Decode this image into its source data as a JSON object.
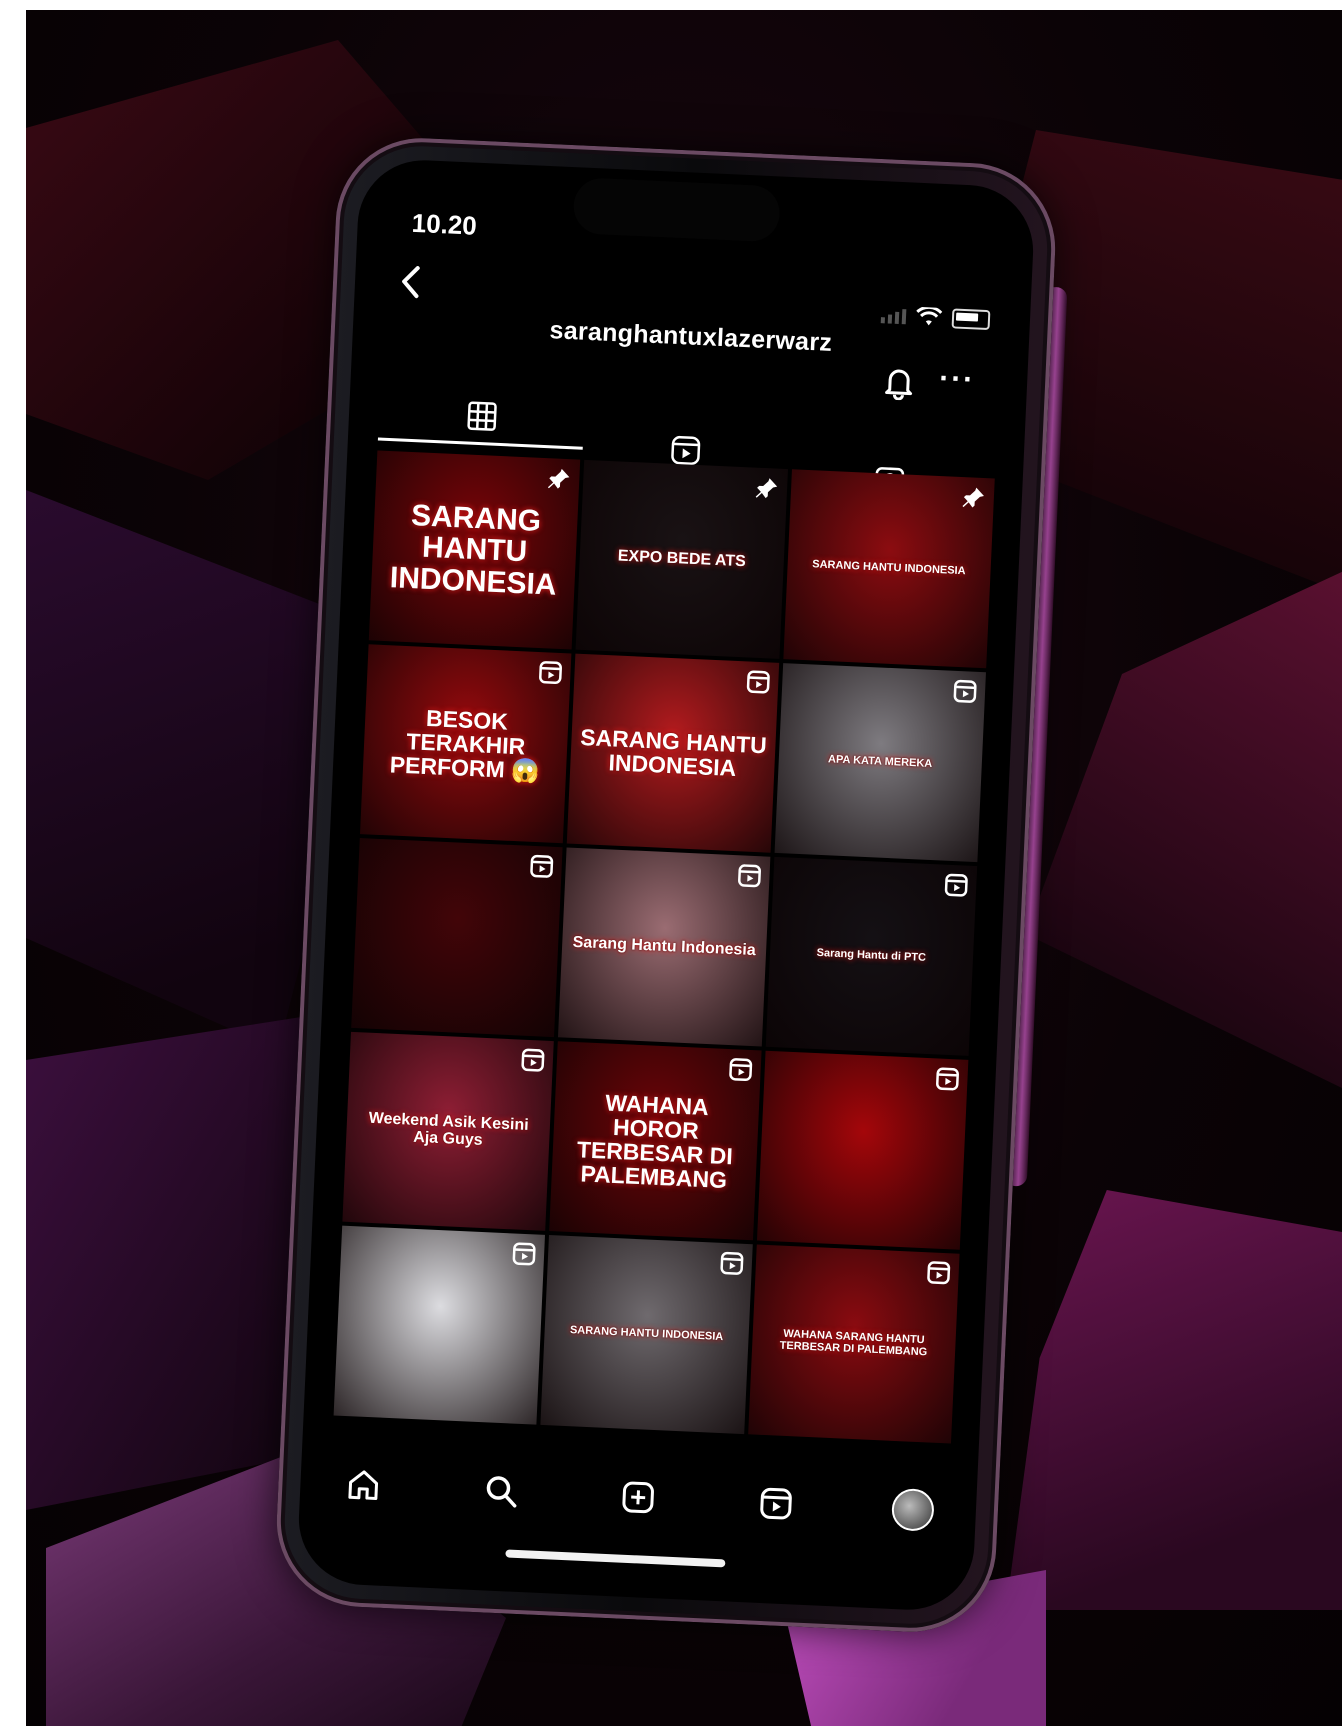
{
  "status_bar": {
    "time": "10.20"
  },
  "profile": {
    "username": "saranghantuxlazerwarz"
  },
  "icons": {
    "back": "chevron-left-icon",
    "bell": "bell-icon",
    "more": "more-horizontal-icon",
    "grid_tab": "grid-icon",
    "reels_tab": "reels-icon",
    "tagged_tab": "tagged-icon",
    "pin": "pin-icon",
    "reel": "reel-icon",
    "home": "home-icon",
    "search": "search-icon",
    "create": "plus-square-icon",
    "reels_nav": "reels-icon",
    "profile": "avatar"
  },
  "colors": {
    "brand_red": "#d4141e",
    "accent_magenta": "#d15cc6",
    "screen_bg": "#000000",
    "text": "#ffffff"
  },
  "posts": [
    {
      "caption": "SARANG HANTU INDONESIA",
      "style": "xl",
      "badge": "pin",
      "bg": "#7a0508"
    },
    {
      "caption": "EXPO BEDE ATS",
      "style": "m",
      "badge": "pin",
      "bg": "#191214"
    },
    {
      "caption": "SARANG HANTU INDONESIA",
      "style": "s",
      "badge": "pin",
      "bg": "#8c0c10"
    },
    {
      "caption": "BESOK TERAKHIR PERFORM 😱",
      "style": "l",
      "badge": "reel",
      "bg": "#950a0d"
    },
    {
      "caption": "SARANG HANTU INDONESIA",
      "style": "l",
      "badge": "reel",
      "bg": "#b31b1e"
    },
    {
      "caption": "APA KATA MEREKA",
      "style": "s",
      "badge": "reel",
      "bg": "#7e7b80"
    },
    {
      "caption": "",
      "style": "s",
      "badge": "reel",
      "bg": "#420508"
    },
    {
      "caption": "Sarang Hantu Indonesia",
      "style": "m",
      "badge": "reel",
      "bg": "#9a6c72"
    },
    {
      "caption": "Sarang Hantu di PTC",
      "style": "s",
      "badge": "reel",
      "bg": "#141014"
    },
    {
      "caption": "Weekend Asik Kesini Aja Guys",
      "style": "m",
      "badge": "reel",
      "bg": "#8e1e34"
    },
    {
      "caption": "WAHANA HOROR TERBESAR DI PALEMBANG",
      "style": "l",
      "badge": "reel",
      "bg": "#6d0508"
    },
    {
      "caption": "",
      "style": "s",
      "badge": "reel",
      "bg": "#a4060a"
    },
    {
      "caption": "",
      "style": "s",
      "badge": "reel",
      "bg": "#dcdce0"
    },
    {
      "caption": "SARANG HANTU INDONESIA",
      "style": "s",
      "badge": "reel",
      "bg": "#6f6a6e"
    },
    {
      "caption": "WAHANA SARANG HANTU TERBESAR DI PALEMBANG",
      "style": "s",
      "badge": "reel",
      "bg": "#8a0b10"
    }
  ]
}
